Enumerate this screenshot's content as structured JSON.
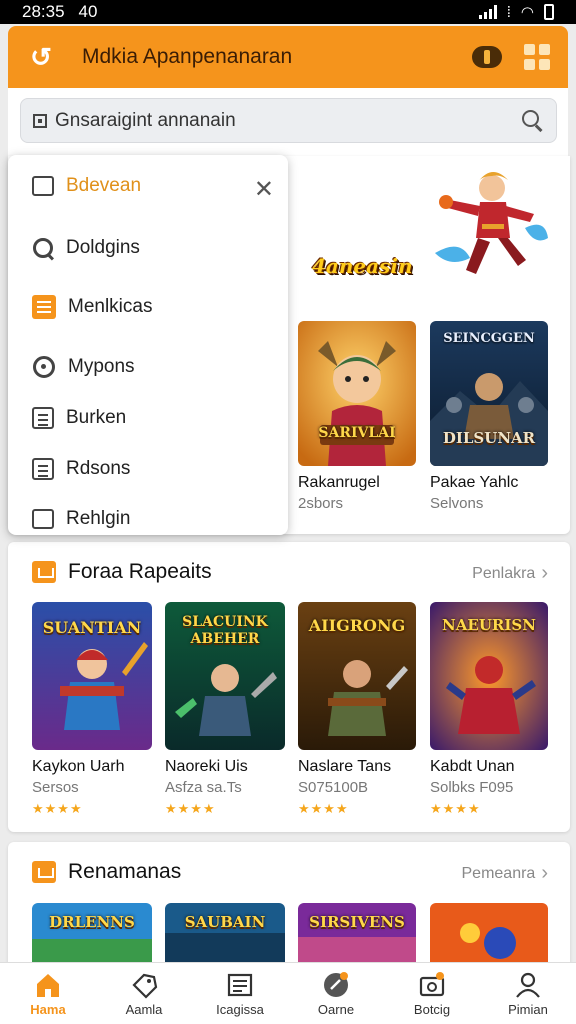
{
  "status": {
    "time": "28:35",
    "extra": "40"
  },
  "appbar": {
    "title": "Mdkia Apanpenanaran"
  },
  "search": {
    "placeholder": "Gnsaraigint annanain"
  },
  "dropdown": {
    "items": [
      {
        "label": "Bdevean",
        "icon": "square-icon",
        "highlight": true
      },
      {
        "label": "Doldgins",
        "icon": "search-icon"
      },
      {
        "label": "Menlkicas",
        "icon": "menu-icon"
      },
      {
        "label": "Mypons",
        "icon": "radar-icon"
      },
      {
        "label": "Burken",
        "icon": "calculator-icon"
      },
      {
        "label": "Rdsons",
        "icon": "list-icon"
      },
      {
        "label": "Rehlgin",
        "icon": "search-doc-icon"
      }
    ]
  },
  "featured": {
    "logo_text": "4aneasin",
    "games": [
      {
        "name": "Rakanrugel",
        "sub": "2sbors",
        "art": "SARIVLAI"
      },
      {
        "name": "Pakae Yahlc",
        "sub": "Selvons",
        "art_top": "SEINCGGEN",
        "art": "DILSUNAR"
      }
    ]
  },
  "section1": {
    "title": "Foraa Rapeaits",
    "see_all": "Penlakra",
    "games": [
      {
        "name": "Kaykon Uarh",
        "sub": "Sersos",
        "rating": 4,
        "art": "SUANTIAN"
      },
      {
        "name": "Naoreki Uis",
        "sub": "Asfza sa.Ts",
        "rating": 4,
        "art": "SLACUINK ABEHER"
      },
      {
        "name": "Naslare Tans",
        "sub": "S075100B",
        "rating": 4,
        "art": "AIIGRONG"
      },
      {
        "name": "Kabdt Unan",
        "sub": "Solbks F095",
        "rating": 4,
        "art": "NAEURISN"
      }
    ]
  },
  "section2": {
    "title": "Renamanas",
    "see_all": "Pemeanra",
    "games": [
      {
        "art": "DRLENNS"
      },
      {
        "art": "SAUBAIN"
      },
      {
        "art": "SIRSIVENS"
      },
      {
        "art": ""
      }
    ]
  },
  "nav": {
    "items": [
      {
        "label": "Hama",
        "icon": "home-icon",
        "active": true
      },
      {
        "label": "Aamla",
        "icon": "tag-icon"
      },
      {
        "label": "Icagissa",
        "icon": "grid-list-icon"
      },
      {
        "label": "Oarne",
        "icon": "game-icon"
      },
      {
        "label": "Botcig",
        "icon": "camera-icon"
      },
      {
        "label": "Pimian",
        "icon": "person-icon"
      }
    ]
  },
  "colors": {
    "accent": "#f5941c",
    "star": "#f5a61c"
  }
}
